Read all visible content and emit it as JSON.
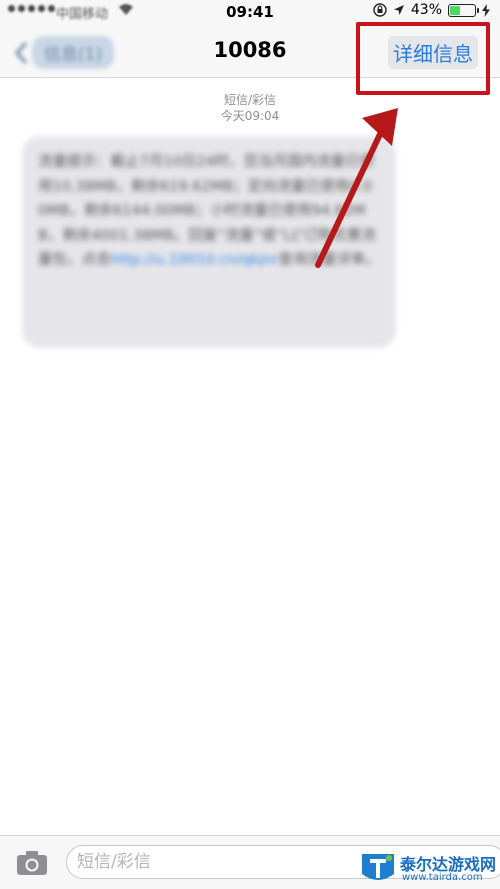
{
  "status_bar": {
    "carrier": "中国移动",
    "time": "09:41",
    "battery_percent": "43%",
    "battery_level": 0.43,
    "icons": [
      "signal-dots-icon",
      "wifi-icon",
      "orientation-lock-icon",
      "location-arrow-icon",
      "battery-icon",
      "charging-bolt-icon"
    ]
  },
  "nav": {
    "back_label": "信息(1)",
    "title": "10086",
    "details_label": "详细信息"
  },
  "message": {
    "type_label": "短信/彩信",
    "timestamp": "今天09:04",
    "body": "流量提示：截止7月10日24时，您当月国内流量已使用10.38MB，剩余619.62MB；定向流量已使用0.00MB，剩余6144.00MB；小时流量已使用94.62MB，剩余4001.38MB。回复“流量”或“LL”订购优惠流量包，点击",
    "link": "http://u.10010.cn/qkjnr",
    "body_tail": "查询流量详单。"
  },
  "input_bar": {
    "placeholder": "短信/彩信"
  },
  "watermark": {
    "name": "泰尔达游戏网",
    "url": "www.tairda.com"
  },
  "colors": {
    "accent": "#2a7be4",
    "highlight_red": "#c8131b",
    "bubble": "#e6e6ea",
    "battery_green": "#4cd964"
  }
}
